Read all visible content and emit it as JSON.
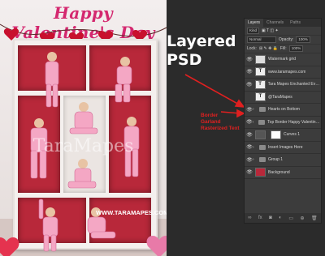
{
  "image": {
    "title": "Happy Valentine's Day",
    "watermark": "TaraMapes",
    "url_text": "WWW.TARAMAPES.COM"
  },
  "overlay": {
    "headline_line1": "Layered",
    "headline_line2": "PSD",
    "note_line1": "Border",
    "note_line2": "Garland",
    "note_line3": "Rasterized Text"
  },
  "layers_panel": {
    "tabs": [
      "Layers",
      "Channels",
      "Paths"
    ],
    "filter_kind": "Kind",
    "blend_mode": "Normal",
    "opacity_label": "Opacity:",
    "opacity_value": "100%",
    "lock_label": "Lock:",
    "fill_label": "Fill:",
    "fill_value": "100%",
    "layers": [
      {
        "name": "Watermark grid",
        "type": "image",
        "visible": true
      },
      {
        "name": "www.taramapes.com",
        "type": "text",
        "visible": true
      },
      {
        "name": "Tara Mapes Enchanted Eve Creation...",
        "type": "text",
        "visible": true
      },
      {
        "name": "@TaraMapes",
        "type": "text",
        "visible": false
      },
      {
        "name": "Hearts on Bottom",
        "type": "group",
        "visible": true
      },
      {
        "name": "Top Border Happy Valentine Day",
        "type": "group",
        "visible": true
      },
      {
        "name": "Curves 1",
        "type": "adjustment",
        "visible": true
      },
      {
        "name": "Insert Images Here",
        "type": "group",
        "visible": true
      },
      {
        "name": "Group 1",
        "type": "group",
        "visible": true
      },
      {
        "name": "Background",
        "type": "image",
        "visible": true
      }
    ]
  },
  "colors": {
    "accent_pink": "#d4286f",
    "shelf_red": "#b8283a",
    "note_red": "#e02020"
  }
}
